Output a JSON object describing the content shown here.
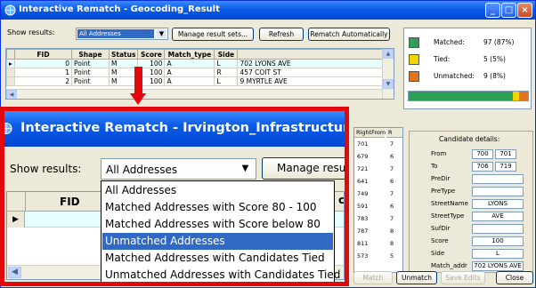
{
  "main_window": {
    "title": "Interactive Rematch - Geocoding_Result",
    "controls": {
      "minimize": "_",
      "maximize": "□",
      "close": "×"
    }
  },
  "toolbar": {
    "show_results_label": "Show results:",
    "show_results_value": "All Addresses",
    "manage_button": "Manage result sets...",
    "refresh_button": "Refresh",
    "rematch_auto_button": "Rematch Automatically"
  },
  "results_table": {
    "columns": [
      "FID",
      "Shape",
      "Status",
      "Score",
      "Match_type",
      "Side",
      ""
    ],
    "rows": [
      {
        "fid": "0",
        "shape": "Point",
        "status": "M",
        "score": "100",
        "match_type": "A",
        "side": "L",
        "address": "702 LYONS AVE"
      },
      {
        "fid": "1",
        "shape": "Point",
        "status": "M",
        "score": "100",
        "match_type": "A",
        "side": "R",
        "address": "457 COIT ST"
      },
      {
        "fid": "2",
        "shape": "Point",
        "status": "M",
        "score": "100",
        "match_type": "A",
        "side": "L",
        "address": "9 MYRTLE AVE"
      }
    ]
  },
  "stats": {
    "matched_label": "Matched:",
    "matched_value": "97 (87%)",
    "tied_label": "Tied:",
    "tied_value": "5 (5%)",
    "unmatched_label": "Unmatched:",
    "unmatched_value": "9 (8%)",
    "matched_fraction": 0.87,
    "tied_fraction": 0.05,
    "unmatched_fraction": 0.08,
    "colors": {
      "matched": "#2e9e57",
      "tied": "#f1d400",
      "unmatched": "#e2741f"
    }
  },
  "candidates_table": {
    "header_right_from": "RightFrom",
    "header_r": "R",
    "right_from_values": [
      "701",
      "679",
      "721",
      "641",
      "749",
      "591",
      "783",
      "787",
      "811",
      "573"
    ],
    "r_values": [
      "7",
      "6",
      "7",
      "6",
      "7",
      "6",
      "7",
      "8",
      "8",
      "5"
    ]
  },
  "candidate_details": {
    "title": "Candidate details:",
    "fields": [
      {
        "label": "From",
        "values": [
          "700",
          "701"
        ]
      },
      {
        "label": "To",
        "values": [
          "706",
          "719"
        ]
      },
      {
        "label": "PreDir",
        "values": [
          ""
        ]
      },
      {
        "label": "PreType",
        "values": [
          ""
        ]
      },
      {
        "label": "StreetName",
        "values": [
          "LYONS"
        ]
      },
      {
        "label": "StreetType",
        "values": [
          "AVE"
        ]
      },
      {
        "label": "SufDir",
        "values": [
          ""
        ]
      },
      {
        "label": "Score",
        "values": [
          "100"
        ]
      },
      {
        "label": "Side",
        "values": [
          "L"
        ]
      },
      {
        "label": "Match_addr",
        "values": [
          "702 LYONS AVE"
        ]
      }
    ]
  },
  "bottom_buttons": {
    "match": "Match",
    "unmatch": "Unmatch",
    "save_edits": "Save Edits",
    "close": "Close"
  },
  "inset": {
    "title": "Interactive Rematch - Irvington_Infrastructure",
    "show_results_label": "Show results:",
    "combo_value": "All Addresses",
    "manage_button": "Manage resul",
    "fid_header": "FID",
    "ch_fragment": "ch",
    "dropdown_options": [
      "All Addresses",
      "Matched Addresses with Score 80 - 100",
      "Matched Addresses with Score below 80",
      "Unmatched Addresses",
      "Matched Addresses with Candidates Tied",
      "Unmatched Addresses with Candidates Tied"
    ],
    "highlighted_index": 3
  }
}
